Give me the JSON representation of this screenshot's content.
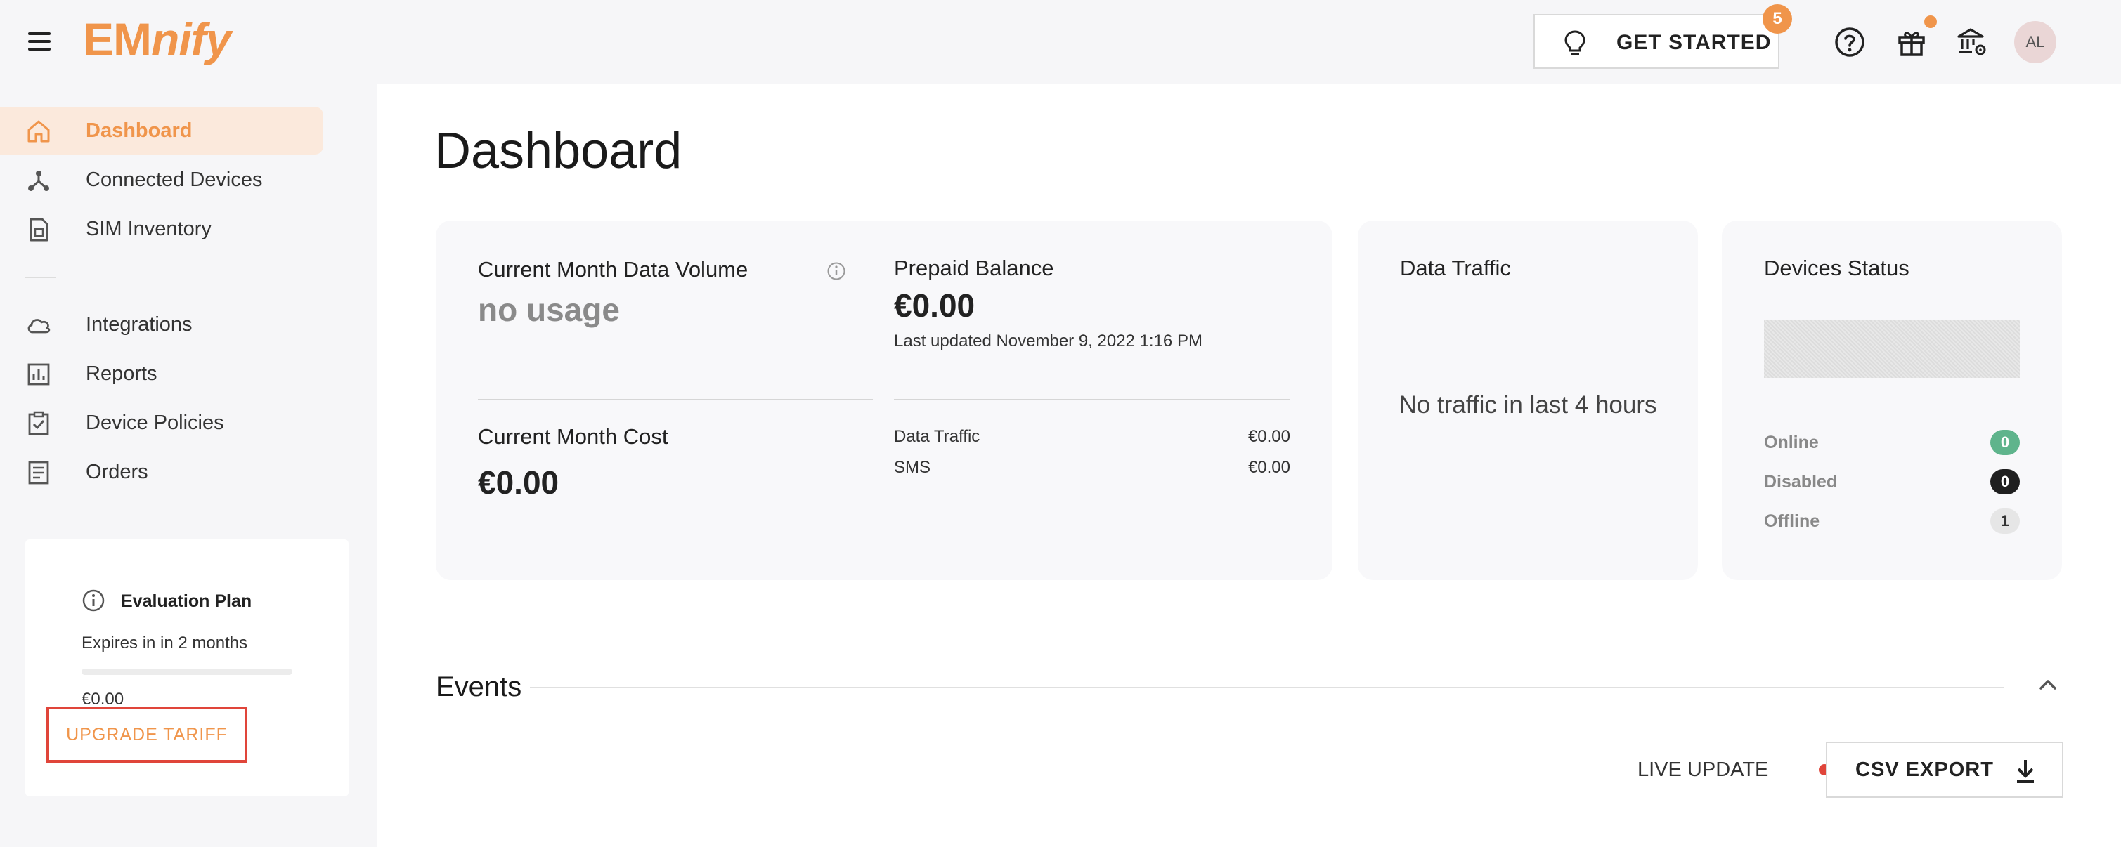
{
  "header": {
    "logo_prefix": "EM",
    "logo_suffix": "nify",
    "get_started_label": "GET STARTED",
    "get_started_badge": "5",
    "avatar_initials": "AL",
    "icons": [
      "menu-icon",
      "lightbulb-icon",
      "help-icon",
      "gift-icon",
      "bank-settings-icon"
    ]
  },
  "sidebar": {
    "items": [
      {
        "label": "Dashboard",
        "icon": "home-icon",
        "active": true
      },
      {
        "label": "Connected Devices",
        "icon": "network-icon"
      },
      {
        "label": "SIM Inventory",
        "icon": "sim-icon"
      },
      {
        "label": "Integrations",
        "icon": "cloud-icon"
      },
      {
        "label": "Reports",
        "icon": "chart-icon"
      },
      {
        "label": "Device Policies",
        "icon": "clipboard-check-icon"
      },
      {
        "label": "Orders",
        "icon": "document-icon"
      }
    ],
    "plan": {
      "name": "Evaluation Plan",
      "expires": "Expires in in 2 months",
      "amount": "€0.00",
      "upgrade_label": "UPGRADE TARIFF"
    }
  },
  "main": {
    "title": "Dashboard",
    "usage_card": {
      "data_volume_label": "Current Month Data Volume",
      "data_volume_value": "no usage",
      "prepaid_label": "Prepaid Balance",
      "prepaid_value": "€0.00",
      "last_updated": "Last updated November 9, 2022 1:16 PM",
      "cost_label": "Current Month Cost",
      "cost_value": "€0.00",
      "breakdown": [
        {
          "label": "Data Traffic",
          "value": "€0.00"
        },
        {
          "label": "SMS",
          "value": "€0.00"
        }
      ]
    },
    "traffic_card": {
      "title": "Data Traffic",
      "message": "No traffic in last 4 hours"
    },
    "status_card": {
      "title": "Devices Status",
      "rows": [
        {
          "label": "Online",
          "count": "0",
          "color": "#5fb48c",
          "text_color": "#ffffff"
        },
        {
          "label": "Disabled",
          "count": "0",
          "color": "#1f1f1f",
          "text_color": "#ffffff"
        },
        {
          "label": "Offline",
          "count": "1",
          "color": "#e6e6e6",
          "text_color": "#333333"
        }
      ]
    },
    "events": {
      "title": "Events",
      "live_update_label": "LIVE UPDATE",
      "csv_export_label": "CSV EXPORT"
    }
  },
  "colors": {
    "accent": "#f0954b",
    "highlight_border": "#e0453a",
    "active_bg": "#fbe9dc"
  }
}
